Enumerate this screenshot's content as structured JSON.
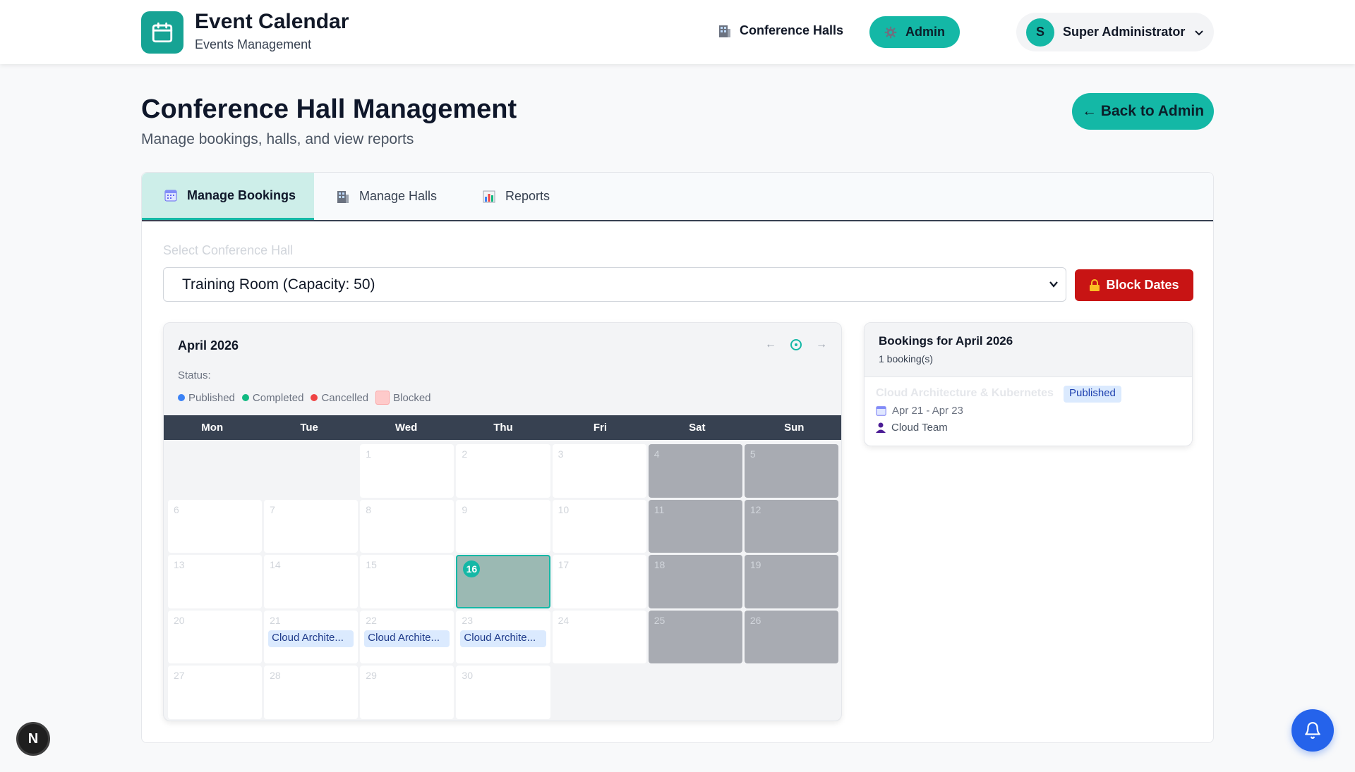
{
  "header": {
    "app_title": "Event Calendar",
    "app_subtitle": "Events Management",
    "nav_halls": "Conference Halls",
    "nav_admin": "Admin",
    "user_initial": "S",
    "user_name": "Super Administrator"
  },
  "page": {
    "title": "Conference Hall Management",
    "subtitle": "Manage bookings, halls, and view reports",
    "back_button": "← Back to Admin"
  },
  "tabs": [
    {
      "label": "Manage Bookings",
      "icon": "calendar-icon",
      "active": true
    },
    {
      "label": "Manage Halls",
      "icon": "building-icon",
      "active": false
    },
    {
      "label": "Reports",
      "icon": "bar-chart-icon",
      "active": false
    }
  ],
  "form": {
    "hall_label": "Select Conference Hall",
    "hall_selected": "Training Room (Capacity: 50)",
    "block_button": "Block Dates"
  },
  "calendar": {
    "month": "April 2026",
    "nav_prev": "←",
    "nav_next": "→",
    "status_label": "Status:",
    "legend": {
      "published": "Published",
      "completed": "Completed",
      "cancelled": "Cancelled",
      "blocked": "Blocked"
    },
    "legend_colors": {
      "published": "#3b82f6",
      "completed": "#10b981",
      "cancelled": "#ef4444",
      "blocked": "#fecaca"
    },
    "weekdays": [
      "Mon",
      "Tue",
      "Wed",
      "Thu",
      "Fri",
      "Sat",
      "Sun"
    ],
    "event_label": "Cloud Archite...",
    "today": "16"
  },
  "bookings": {
    "title": "Bookings for April 2026",
    "count": "1 booking(s)",
    "event_name": "Cloud Architecture & Kubernetes",
    "status": "Published",
    "dates": "Apr 21 - Apr 23",
    "organizer": "Cloud Team"
  },
  "floating": {
    "dev_badge": "N"
  },
  "colors": {
    "accent": "#14b8a6",
    "danger": "#c81414",
    "dark_header": "#374151"
  }
}
